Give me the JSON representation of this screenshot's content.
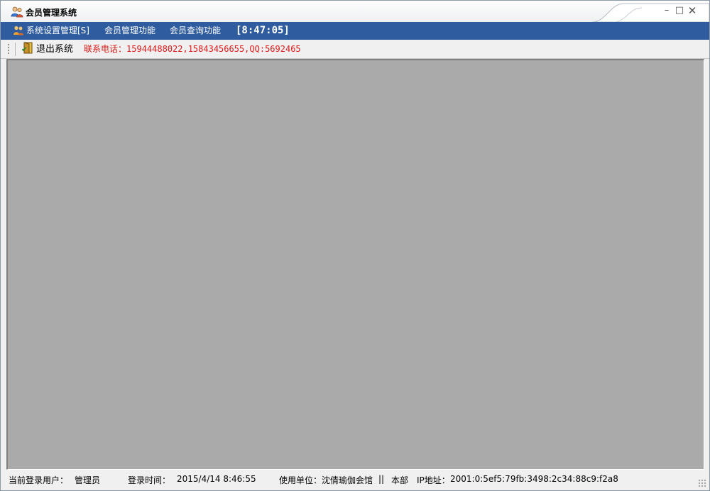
{
  "window": {
    "title": "会员管理系统"
  },
  "menu": {
    "items": [
      {
        "label": "系统设置管理[S]",
        "icon": "people-icon"
      },
      {
        "label": "会员管理功能"
      },
      {
        "label": "会员查询功能"
      }
    ],
    "clock": "[8:47:05]"
  },
  "toolbar": {
    "exit_label": "退出系统",
    "contact_label": "联系电话：",
    "contact_numbers": "15944488022,15843456655,QQ:5692465"
  },
  "status": {
    "user_label": "当前登录用户：",
    "user_value": "管理员",
    "login_time_label": "登录时间：",
    "login_time_value": "2015/4/14 8:46:55",
    "org_label": "使用单位：",
    "org_value": "沈倩瑜伽会馆",
    "separator": "||",
    "branch": "本部",
    "ip_label": "IP地址：",
    "ip_value": "2001:0:5ef5:79fb:3498:2c34:88c9:f2a8"
  },
  "colors": {
    "menubar": "#2f5c9e",
    "contact_text": "#e01818",
    "client_area": "#aaaaaa"
  }
}
